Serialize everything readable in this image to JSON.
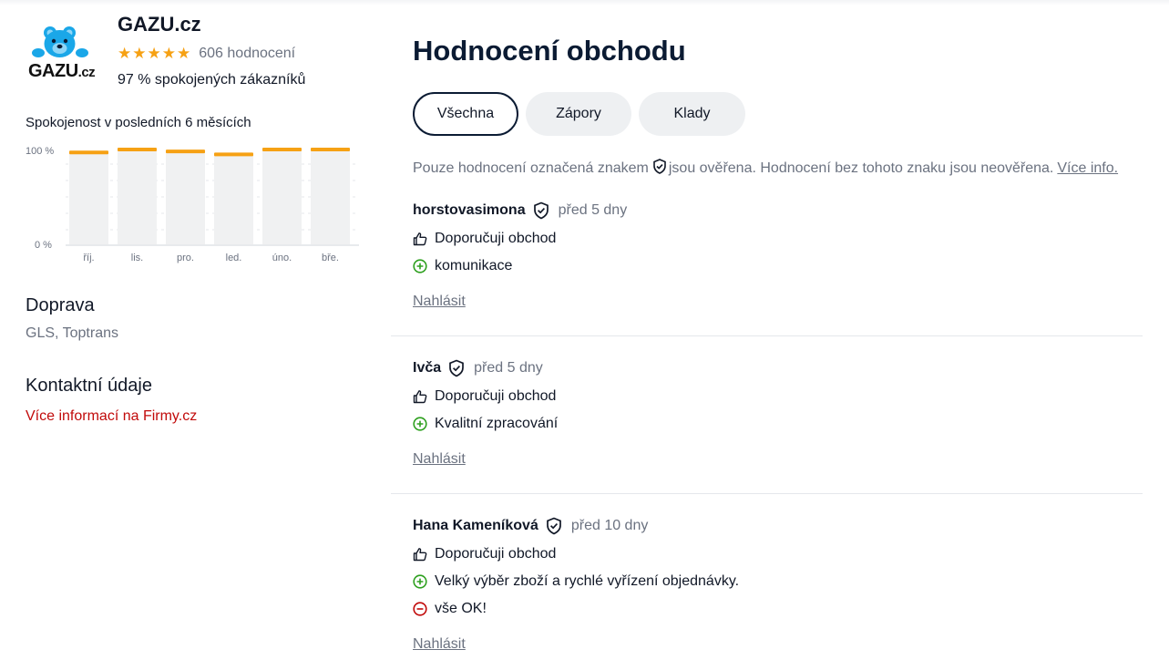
{
  "shop": {
    "logo_text": "GAZU",
    "logo_suffix": ".cz",
    "name": "GAZU.cz",
    "rating_count": "606 hodnocení",
    "satisfied": "97 % spokojených zákazníků"
  },
  "chart_title": "Spokojenost v posledních 6 měsících",
  "chart_data": {
    "type": "bar",
    "categories": [
      "říj.",
      "lis.",
      "pro.",
      "led.",
      "úno.",
      "bře."
    ],
    "values": [
      97,
      100,
      98,
      95,
      100,
      100
    ],
    "ylim": [
      0,
      100
    ],
    "ytick_labels": [
      "100 %",
      "0 %"
    ],
    "colors": {
      "bar": "#f0f1f2",
      "marker": "#f6a114"
    }
  },
  "delivery": {
    "title": "Doprava",
    "value": "GLS, Toptrans"
  },
  "contact": {
    "title": "Kontaktní údaje",
    "link": "Více informací na Firmy.cz"
  },
  "main": {
    "title": "Hodnocení obchodu",
    "tabs": [
      "Všechna",
      "Zápory",
      "Klady"
    ],
    "notice_before": "Pouze hodnocení označená znakem",
    "notice_after": "jsou ověřena. Hodnocení bez tohoto znaku jsou neověřena.",
    "notice_link": "Více info."
  },
  "reviews": [
    {
      "author": "horstovasimona",
      "date": "před 5 dny",
      "recommend": "Doporučuji obchod",
      "pros": [
        "komunikace"
      ],
      "cons": [],
      "report": "Nahlásit"
    },
    {
      "author": "Ivča",
      "date": "před 5 dny",
      "recommend": "Doporučuji obchod",
      "pros": [
        "Kvalitní zpracování"
      ],
      "cons": [],
      "report": "Nahlásit"
    },
    {
      "author": "Hana Kameníková",
      "date": "před 10 dny",
      "recommend": "Doporučuji obchod",
      "pros": [
        "Velký výběr zboží a rychlé vyřízení objednávky."
      ],
      "cons": [
        "vše OK!"
      ],
      "report": "Nahlásit"
    }
  ],
  "colors": {
    "accent": "#0b1b33",
    "star": "#f6a114",
    "pro": "#2ea01f",
    "con": "#c10a0a",
    "link_red": "#c10a0a"
  }
}
